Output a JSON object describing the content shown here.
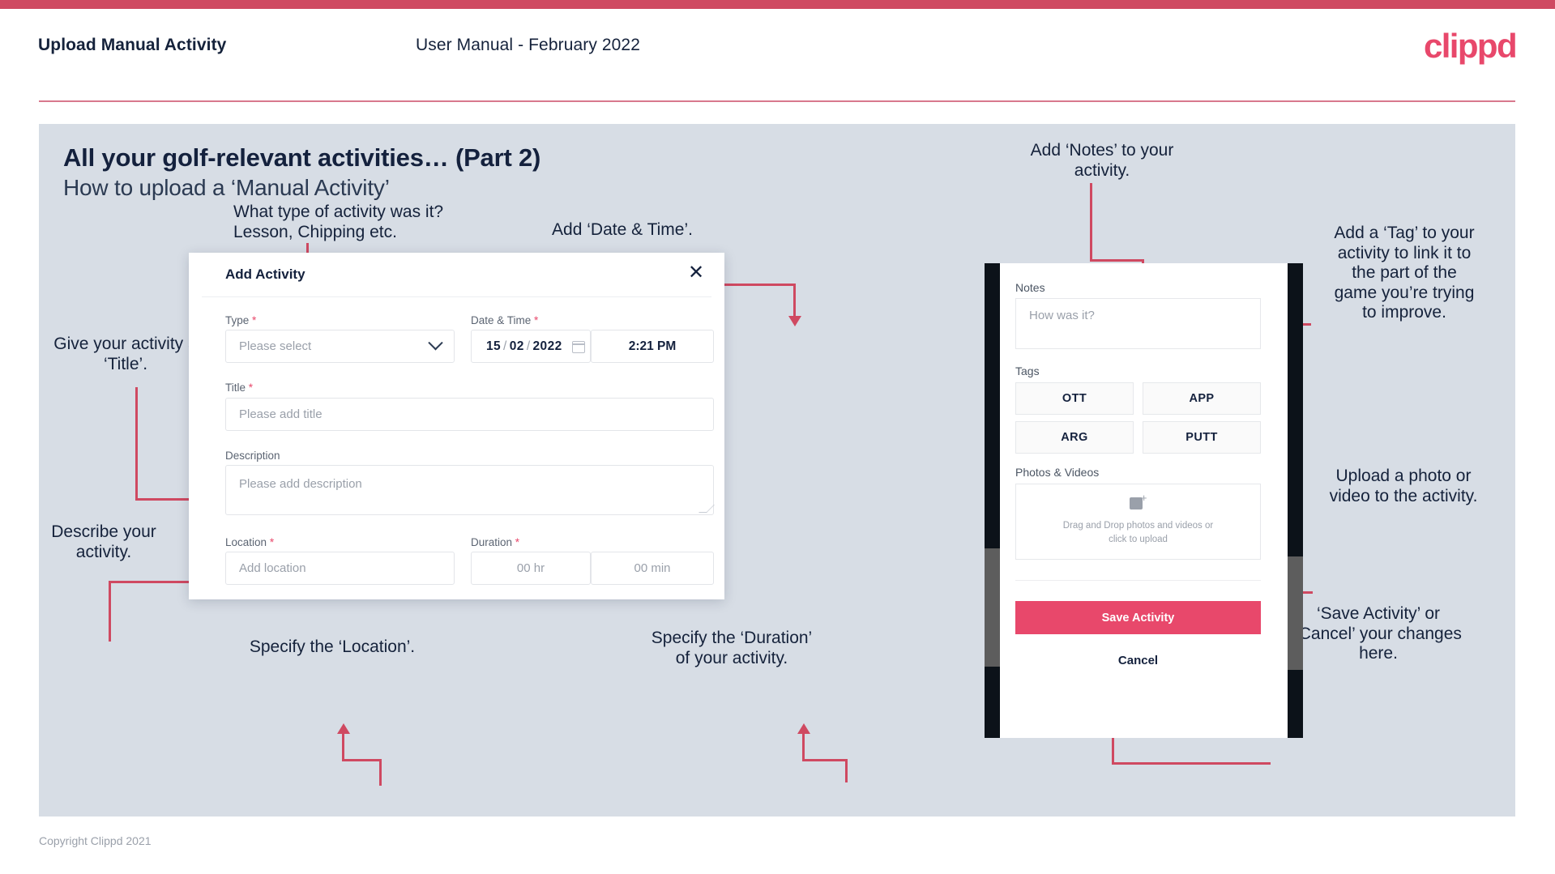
{
  "header": {
    "title": "Upload Manual Activity",
    "subtitle": "User Manual - February 2022",
    "brand": "clippd"
  },
  "slide": {
    "title": "All your golf-relevant activities… (Part 2)",
    "subtitle": "How to upload a ‘Manual Activity’"
  },
  "annotations": {
    "type": "What type of activity was it?\nLesson, Chipping etc.",
    "date_time": "Add ‘Date & Time’.",
    "title_field": "Give your activity a\n‘Title’.",
    "description": "Describe your\nactivity.",
    "location": "Specify the ‘Location’.",
    "duration": "Specify the ‘Duration’\nof your activity.",
    "notes": "Add ‘Notes’ to your\nactivity.",
    "tags": "Add a ‘Tag’ to your\nactivity to link it to\nthe part of the\ngame you’re trying\nto improve.",
    "upload": "Upload a photo or\nvideo to the activity.",
    "save_cancel": "‘Save Activity’ or\n‘Cancel’ your changes\nhere."
  },
  "modal": {
    "title": "Add Activity",
    "close_icon": "close-icon",
    "fields": {
      "type": {
        "label": "Type",
        "required": "*",
        "placeholder": "Please select"
      },
      "date_time": {
        "label": "Date & Time",
        "required": "*",
        "day": "15",
        "month": "02",
        "year": "2022",
        "sep": "/",
        "time": "2:21 PM"
      },
      "title": {
        "label": "Title",
        "required": "*",
        "placeholder": "Please add title"
      },
      "description": {
        "label": "Description",
        "required": "",
        "placeholder": "Please add description"
      },
      "location": {
        "label": "Location",
        "required": "*",
        "placeholder": "Add location"
      },
      "duration": {
        "label": "Duration",
        "required": "*",
        "hours": "00 hr",
        "minutes": "00 min"
      }
    }
  },
  "phone": {
    "notes": {
      "label": "Notes",
      "placeholder": "How was it?"
    },
    "tags": {
      "label": "Tags",
      "items": [
        "OTT",
        "APP",
        "ARG",
        "PUTT"
      ]
    },
    "photos": {
      "label": "Photos & Videos",
      "dropzone_line1": "Drag and Drop photos and videos or",
      "dropzone_line2": "click to upload",
      "icon": "add-image-icon"
    },
    "save_label": "Save Activity",
    "cancel_label": "Cancel"
  },
  "footer": {
    "copyright": "Copyright Clippd 2021"
  },
  "colors": {
    "accent_pink": "#e8486b",
    "line_pink": "#cf4961",
    "slide_bg": "#d7dde5",
    "ink": "#14213d",
    "muted": "#9aa0aa"
  }
}
